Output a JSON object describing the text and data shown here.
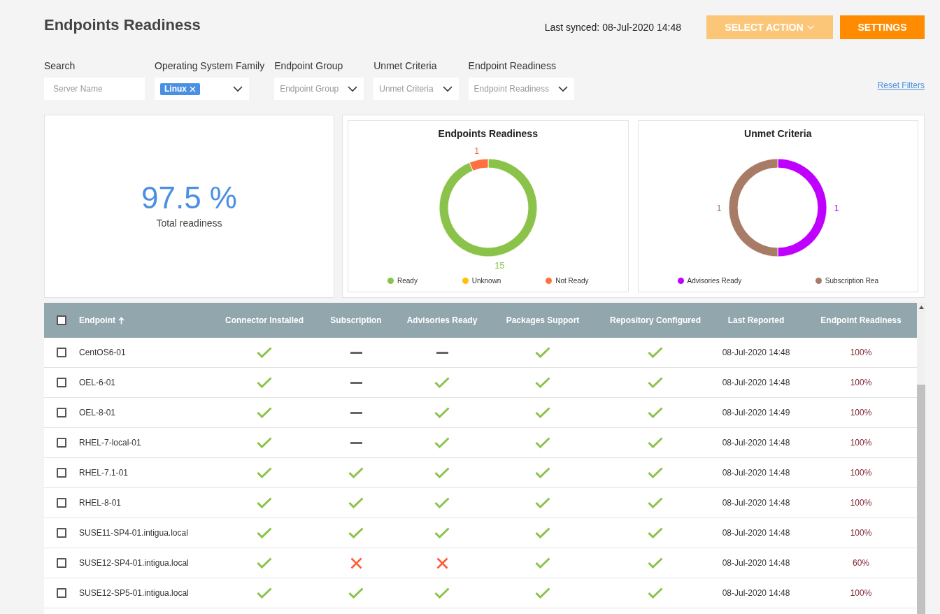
{
  "header": {
    "title": "Endpoints Readiness",
    "last_synced": "Last synced: 08-Jul-2020 14:48",
    "buttons": [
      {
        "label": "SELECT ACTION",
        "kind": "dropdown",
        "disabled": true
      },
      {
        "label": "SETTINGS",
        "kind": "plain",
        "disabled": false
      }
    ]
  },
  "filters": [
    {
      "label": "Search",
      "kind": "text",
      "placeholder": "Server Name"
    },
    {
      "label": "Operating System Family",
      "kind": "select",
      "chips": [
        "Linux"
      ]
    },
    {
      "label": "Endpoint Group",
      "kind": "select",
      "placeholder": "Endpoint Group"
    },
    {
      "label": "Unmet Criteria",
      "kind": "select",
      "placeholder": "Unmet Criteria"
    },
    {
      "label": "Endpoint Readiness",
      "kind": "select",
      "placeholder": "Endpoint Readiness"
    }
  ],
  "reset_filters": "Reset Filters",
  "summary": {
    "value": "97.5 %",
    "caption": "Total readiness"
  },
  "charts": [
    {
      "chart_data": {
        "type": "donut",
        "title": "Endpoints Readiness",
        "categories": [
          "Ready",
          "Unknown",
          "Not Ready"
        ],
        "values": [
          15,
          0,
          1
        ],
        "colors": [
          "#8bc34a",
          "#ffc107",
          "#ff7043"
        ],
        "data_labels": true
      }
    },
    {
      "chart_data": {
        "type": "donut",
        "title": "Unmet Criteria",
        "categories": [
          "Advisories Ready",
          "Subscription Rea"
        ],
        "values": [
          1,
          1
        ],
        "colors": [
          "#c000ff",
          "#a87b67"
        ],
        "data_labels": true
      }
    }
  ],
  "table": {
    "columns": [
      {
        "label": "Endpoint",
        "sorted": true
      },
      {
        "label": "Connector Installed",
        "sorted": false
      },
      {
        "label": "Subscription",
        "sorted": false
      },
      {
        "label": "Advisories Ready",
        "sorted": false
      },
      {
        "label": "Packages Support",
        "sorted": false
      },
      {
        "label": "Repository Configured",
        "sorted": false
      },
      {
        "label": "Last Reported",
        "sorted": false
      },
      {
        "label": "Endpoint Readiness",
        "sorted": false
      }
    ],
    "all_checked": false,
    "rows": [
      {
        "checked": false,
        "endpoint": "CentOS6-01",
        "statuses": [
          {
            "kind": "ok"
          },
          {
            "kind": "na"
          },
          {
            "kind": "na"
          },
          {
            "kind": "ok"
          },
          {
            "kind": "ok"
          }
        ],
        "last_reported": "08-Jul-2020 14:48",
        "readiness": "100%"
      },
      {
        "checked": false,
        "endpoint": "OEL-6-01",
        "statuses": [
          {
            "kind": "ok"
          },
          {
            "kind": "na"
          },
          {
            "kind": "ok"
          },
          {
            "kind": "ok"
          },
          {
            "kind": "ok"
          }
        ],
        "last_reported": "08-Jul-2020 14:48",
        "readiness": "100%"
      },
      {
        "checked": false,
        "endpoint": "OEL-8-01",
        "statuses": [
          {
            "kind": "ok"
          },
          {
            "kind": "na"
          },
          {
            "kind": "ok"
          },
          {
            "kind": "ok"
          },
          {
            "kind": "ok"
          }
        ],
        "last_reported": "08-Jul-2020 14:49",
        "readiness": "100%"
      },
      {
        "checked": false,
        "endpoint": "RHEL-7-local-01",
        "statuses": [
          {
            "kind": "ok"
          },
          {
            "kind": "na"
          },
          {
            "kind": "ok"
          },
          {
            "kind": "ok"
          },
          {
            "kind": "ok"
          }
        ],
        "last_reported": "08-Jul-2020 14:48",
        "readiness": "100%"
      },
      {
        "checked": false,
        "endpoint": "RHEL-7.1-01",
        "statuses": [
          {
            "kind": "ok"
          },
          {
            "kind": "ok"
          },
          {
            "kind": "ok"
          },
          {
            "kind": "ok"
          },
          {
            "kind": "ok"
          }
        ],
        "last_reported": "08-Jul-2020 14:48",
        "readiness": "100%"
      },
      {
        "checked": false,
        "endpoint": "RHEL-8-01",
        "statuses": [
          {
            "kind": "ok"
          },
          {
            "kind": "ok"
          },
          {
            "kind": "ok"
          },
          {
            "kind": "ok"
          },
          {
            "kind": "ok"
          }
        ],
        "last_reported": "08-Jul-2020 14:48",
        "readiness": "100%"
      },
      {
        "checked": false,
        "endpoint": "SUSE11-SP4-01.intigua.local",
        "statuses": [
          {
            "kind": "ok"
          },
          {
            "kind": "ok"
          },
          {
            "kind": "ok"
          },
          {
            "kind": "ok"
          },
          {
            "kind": "ok"
          }
        ],
        "last_reported": "08-Jul-2020 14:48",
        "readiness": "100%"
      },
      {
        "checked": false,
        "endpoint": "SUSE12-SP4-01.intigua.local",
        "statuses": [
          {
            "kind": "ok"
          },
          {
            "kind": "fail"
          },
          {
            "kind": "fail"
          },
          {
            "kind": "ok"
          },
          {
            "kind": "ok"
          }
        ],
        "last_reported": "08-Jul-2020 14:48",
        "readiness": "60%"
      },
      {
        "checked": false,
        "endpoint": "SUSE12-SP5-01.intigua.local",
        "statuses": [
          {
            "kind": "ok"
          },
          {
            "kind": "ok"
          },
          {
            "kind": "ok"
          },
          {
            "kind": "ok"
          },
          {
            "kind": "ok"
          }
        ],
        "last_reported": "08-Jul-2020 14:48",
        "readiness": "100%"
      }
    ]
  }
}
